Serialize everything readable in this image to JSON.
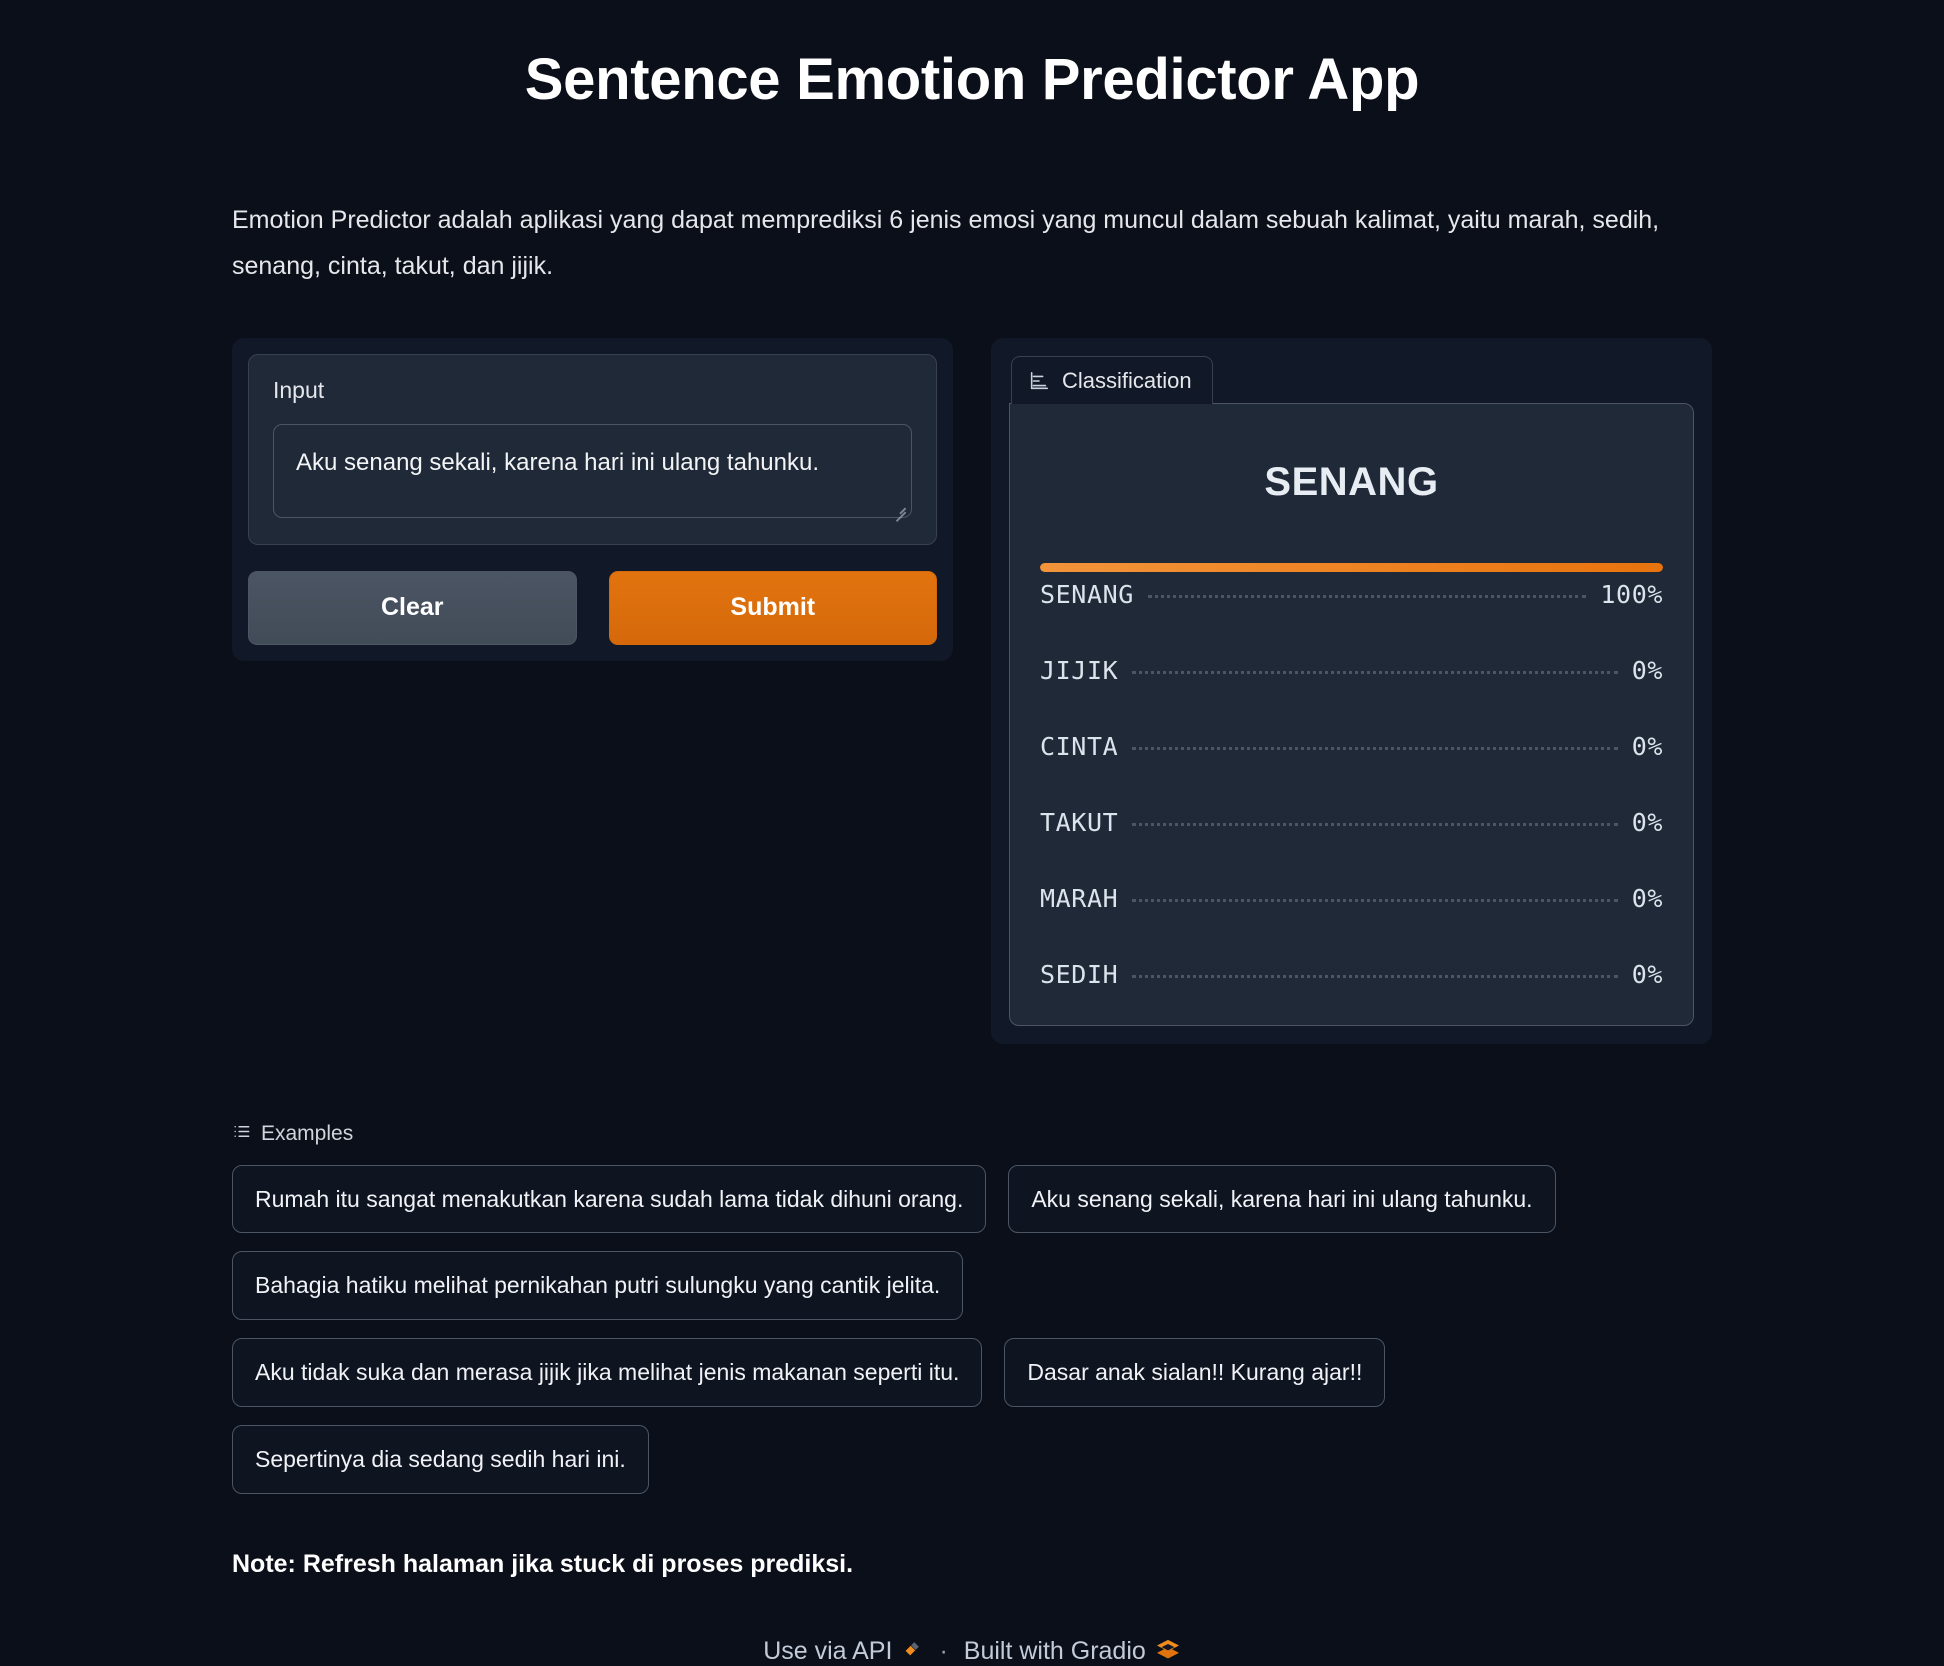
{
  "header": {
    "title": "Sentence Emotion Predictor App"
  },
  "description": "Emotion Predictor adalah aplikasi yang dapat memprediksi 6 jenis emosi yang muncul dalam sebuah kalimat, yaitu marah, sedih, senang, cinta, takut, dan jijik.",
  "input_panel": {
    "label": "Input",
    "value": "Aku senang sekali, karena hari ini ulang tahunku.",
    "placeholder": "",
    "clear_label": "Clear",
    "submit_label": "Submit"
  },
  "output_panel": {
    "label": "Classification",
    "icon": "bar-chart-icon",
    "top_label": "SENANG"
  },
  "chart_data": {
    "type": "bar",
    "title": "Classification",
    "categories": [
      "SENANG",
      "JIJIK",
      "CINTA",
      "TAKUT",
      "MARAH",
      "SEDIH"
    ],
    "values": [
      100,
      0,
      0,
      0,
      0,
      0
    ],
    "value_labels": [
      "100%",
      "0%",
      "0%",
      "0%",
      "0%",
      "0%"
    ],
    "xlabel": "",
    "ylabel": "",
    "xlim": [
      0,
      100
    ],
    "grid": false,
    "legend": "none",
    "accent_color": "#e8730d"
  },
  "examples": {
    "header": "Examples",
    "icon": "list-icon",
    "items": [
      "Rumah itu sangat menakutkan karena sudah lama tidak dihuni orang.",
      "Aku senang sekali, karena hari ini ulang tahunku.",
      "Bahagia hatiku melihat pernikahan putri sulungku yang cantik jelita.",
      "Aku tidak suka dan merasa jijik jika melihat jenis makanan seperti itu.",
      "Dasar anak sialan!! Kurang ajar!!",
      "Sepertinya dia sedang sedih hari ini."
    ]
  },
  "note": "Note: Refresh halaman jika stuck di proses prediksi.",
  "footer": {
    "api_label": "Use via API",
    "api_emoji": "🛰",
    "separator": "·",
    "gradio_label": "Built with Gradio",
    "gradio_emoji": "🧡"
  },
  "colors": {
    "background": "#0b0f19",
    "panel": "#1f2937",
    "wrapper": "#111827",
    "accent": "#dd6b0d",
    "border": "#4b5563"
  }
}
